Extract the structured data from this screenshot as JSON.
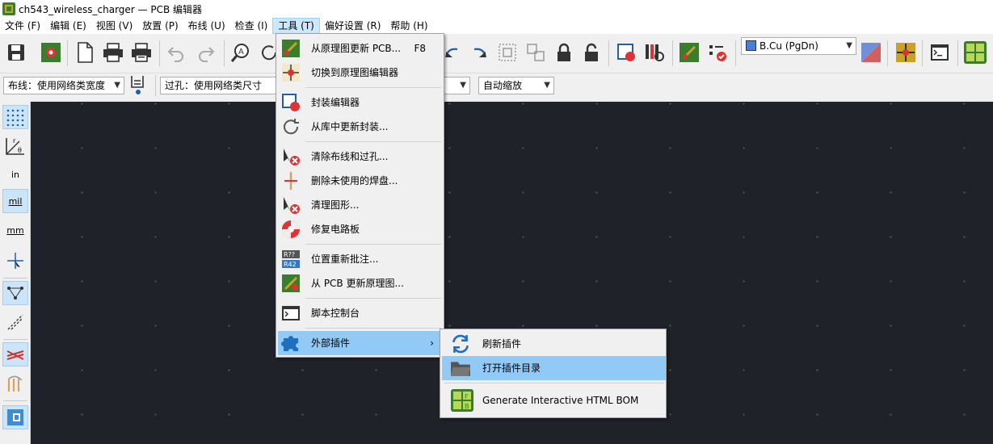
{
  "window": {
    "title": "ch543_wireless_charger — PCB 编辑器"
  },
  "menubar": [
    "文件 (F)",
    "编辑 (E)",
    "视图 (V)",
    "放置 (P)",
    "布线 (U)",
    "检查 (I)",
    "工具 (T)",
    "偏好设置 (R)",
    "帮助 (H)"
  ],
  "toolbar": {
    "layer_select": "B.Cu (PgDn)"
  },
  "toolbar2": {
    "track_width": "布线：使用网络类宽度",
    "via_size": "过孔：使用网络类尺寸",
    "zoom": "自动缩放"
  },
  "left_toolbar": {
    "inches": "in",
    "mils": "mil",
    "millimeters": "mm"
  },
  "tools_menu": {
    "items": [
      {
        "label": "从原理图更新 PCB...",
        "shortcut": "F8",
        "icon": "update-pcb-icon"
      },
      {
        "label": "切换到原理图编辑器",
        "icon": "schematic-editor-icon"
      },
      {
        "label": "封装编辑器",
        "icon": "footprint-editor-icon"
      },
      {
        "label": "从库中更新封装...",
        "icon": "refresh-icon"
      },
      {
        "label": "清除布线和过孔...",
        "icon": "delete-cursor-icon"
      },
      {
        "label": "删除未使用的焊盘...",
        "icon": "unused-pads-icon"
      },
      {
        "label": "清理图形...",
        "icon": "delete-cursor-icon"
      },
      {
        "label": "修复电路板",
        "icon": "repair-icon"
      },
      {
        "label": "位置重新批注...",
        "icon": "reannotate-icon"
      },
      {
        "label": "从 PCB 更新原理图...",
        "icon": "update-schematic-icon"
      },
      {
        "label": "脚本控制台",
        "icon": "console-icon"
      },
      {
        "label": "外部插件",
        "submenu_arrow": "›",
        "icon": "puzzle-icon"
      }
    ]
  },
  "plugins_submenu": {
    "items": [
      {
        "label": "刷新插件",
        "icon": "refresh-icon"
      },
      {
        "label": "打开插件目录",
        "icon": "folder-icon"
      },
      {
        "label": "Generate Interactive HTML BOM",
        "icon": "ibom-icon"
      }
    ]
  },
  "colors": {
    "canvas_bg": "#1f2329",
    "menu_highlight": "#91c9f7",
    "menubar_active": "#cce8ff",
    "layer_swatch": "#4b7fd6"
  }
}
